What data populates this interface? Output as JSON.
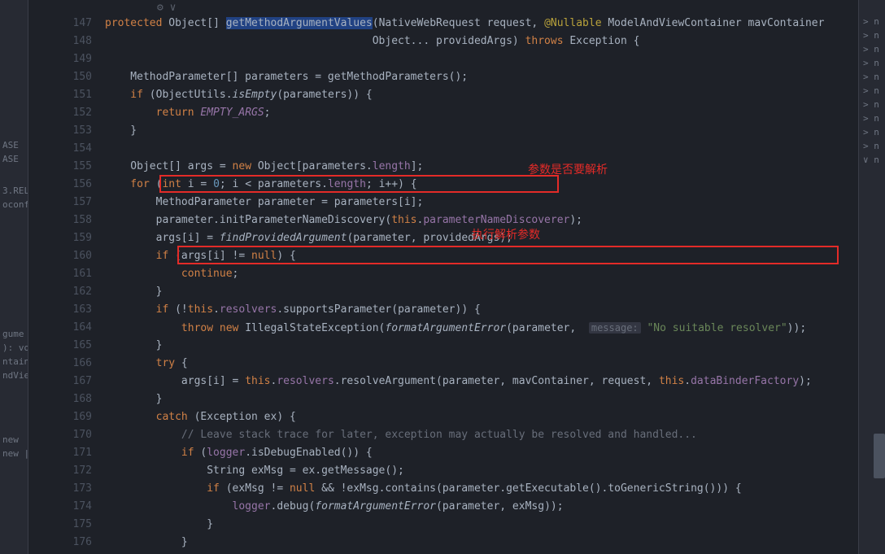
{
  "left_panel": {
    "items": [
      "ASE",
      "ASE",
      "",
      "3.REL",
      "oconf",
      "",
      "",
      "",
      "",
      "",
      "",
      "",
      "gume",
      "): voi",
      "ntaine",
      "ndVie",
      "",
      "",
      "",
      "",
      "new",
      "new |"
    ]
  },
  "right_panel": {
    "items": [
      "",
      "> n",
      "> n",
      "> n",
      "> n",
      "> n",
      "> n",
      "> n",
      "> n",
      "> n",
      "> n",
      "∨ n"
    ]
  },
  "line_numbers": [
    "147",
    "148",
    "149",
    "150",
    "151",
    "152",
    "153",
    "154",
    "155",
    "156",
    "157",
    "158",
    "159",
    "160",
    "161",
    "162",
    "163",
    "164",
    "165",
    "166",
    "167",
    "168",
    "169",
    "170",
    "171",
    "172",
    "173",
    "174",
    "175",
    "176"
  ],
  "annotations": {
    "ann1": "参数是否要解析",
    "ann2": "执行解析参数"
  },
  "code": {
    "l147": {
      "protected": "protected",
      "object": "Object",
      "brackets": "[]",
      "method": "getMethodArgumentValues",
      "open": "(",
      "nwr": "NativeWebRequest request, ",
      "nullable": "@Nullable",
      "mav": " ModelAndViewContainer mavContainer"
    },
    "l148": {
      "text1": "                                          Object... providedArgs) ",
      "throws": "throws",
      "text2": " Exception {"
    },
    "l150": {
      "text": "    MethodParameter[] parameters = getMethodParameters();"
    },
    "l151": {
      "if": "    if",
      "open": " (ObjectUtils.",
      "isEmpty": "isEmpty",
      "close": "(parameters)) {"
    },
    "l152": {
      "return": "        return",
      "empty": " EMPTY_ARGS",
      "semi": ";"
    },
    "l153": {
      "text": "    }"
    },
    "l155": {
      "text1": "    Object[] args = ",
      "new": "new",
      "text2": " Object[parameters.",
      "length": "length",
      "close": "];"
    },
    "l156": {
      "for": "    for",
      "open": " (",
      "int": "int",
      "i": " i = ",
      "zero": "0",
      "mid": "; i < parameters.",
      "length": "length",
      "end": "; i++) {"
    },
    "l157": {
      "text": "        MethodParameter parameter = parameters[i];"
    },
    "l158": {
      "text1": "        parameter.initParameterNameDiscovery(",
      "this": "this",
      "dot": ".",
      "field": "parameterNameDiscoverer",
      "close": ");"
    },
    "l159": {
      "text1": "        args[i] = ",
      "method": "findProvidedArgument",
      "args": "(parameter, providedArgs);"
    },
    "l160": {
      "if": "        if",
      "cond": " (args[i] != ",
      "null": "null",
      "close": ") {"
    },
    "l161": {
      "continue": "            continue",
      "semi": ";"
    },
    "l162": {
      "text": "        }"
    },
    "l163": {
      "if": "        if",
      "open": " (!",
      "this": "this",
      "dot": ".",
      "resolvers": "resolvers",
      "call": ".supportsParameter(parameter)) {"
    },
    "l164": {
      "throw": "            throw",
      "new": " new",
      "text1": " IllegalStateException(",
      "method": "formatArgumentError",
      "text2": "(parameter, ",
      "hint": "message:",
      "string": " \"No suitable resolver\"",
      "close": "));"
    },
    "l165": {
      "text": "        }"
    },
    "l166": {
      "try": "        try",
      "open": " {"
    },
    "l167": {
      "text1": "            args[i] = ",
      "this1": "this",
      "dot1": ".",
      "resolvers": "resolvers",
      "call": ".resolveArgument(parameter, mavContainer, request, ",
      "this2": "this",
      "dot2": ".",
      "field": "dataBinderFactory",
      "close": ");"
    },
    "l168": {
      "text": "        }"
    },
    "l169": {
      "catch": "        catch",
      "args": " (Exception ex) {"
    },
    "l170": {
      "comment": "            // Leave stack trace for later, exception may actually be resolved and handled..."
    },
    "l171": {
      "if": "            if",
      "open": " (",
      "logger": "logger",
      "call": ".isDebugEnabled()) {"
    },
    "l172": {
      "text": "                String exMsg = ex.getMessage();"
    },
    "l173": {
      "if": "                if",
      "open": " (exMsg != ",
      "null": "null",
      "text": " && !exMsg.contains(parameter.getExecutable().toGenericString())) {"
    },
    "l174": {
      "logger": "                    logger",
      "call": ".debug(",
      "method": "formatArgumentError",
      "args": "(parameter, exMsg));"
    },
    "l175": {
      "text": "                }"
    },
    "l176": {
      "text": "            }"
    }
  }
}
